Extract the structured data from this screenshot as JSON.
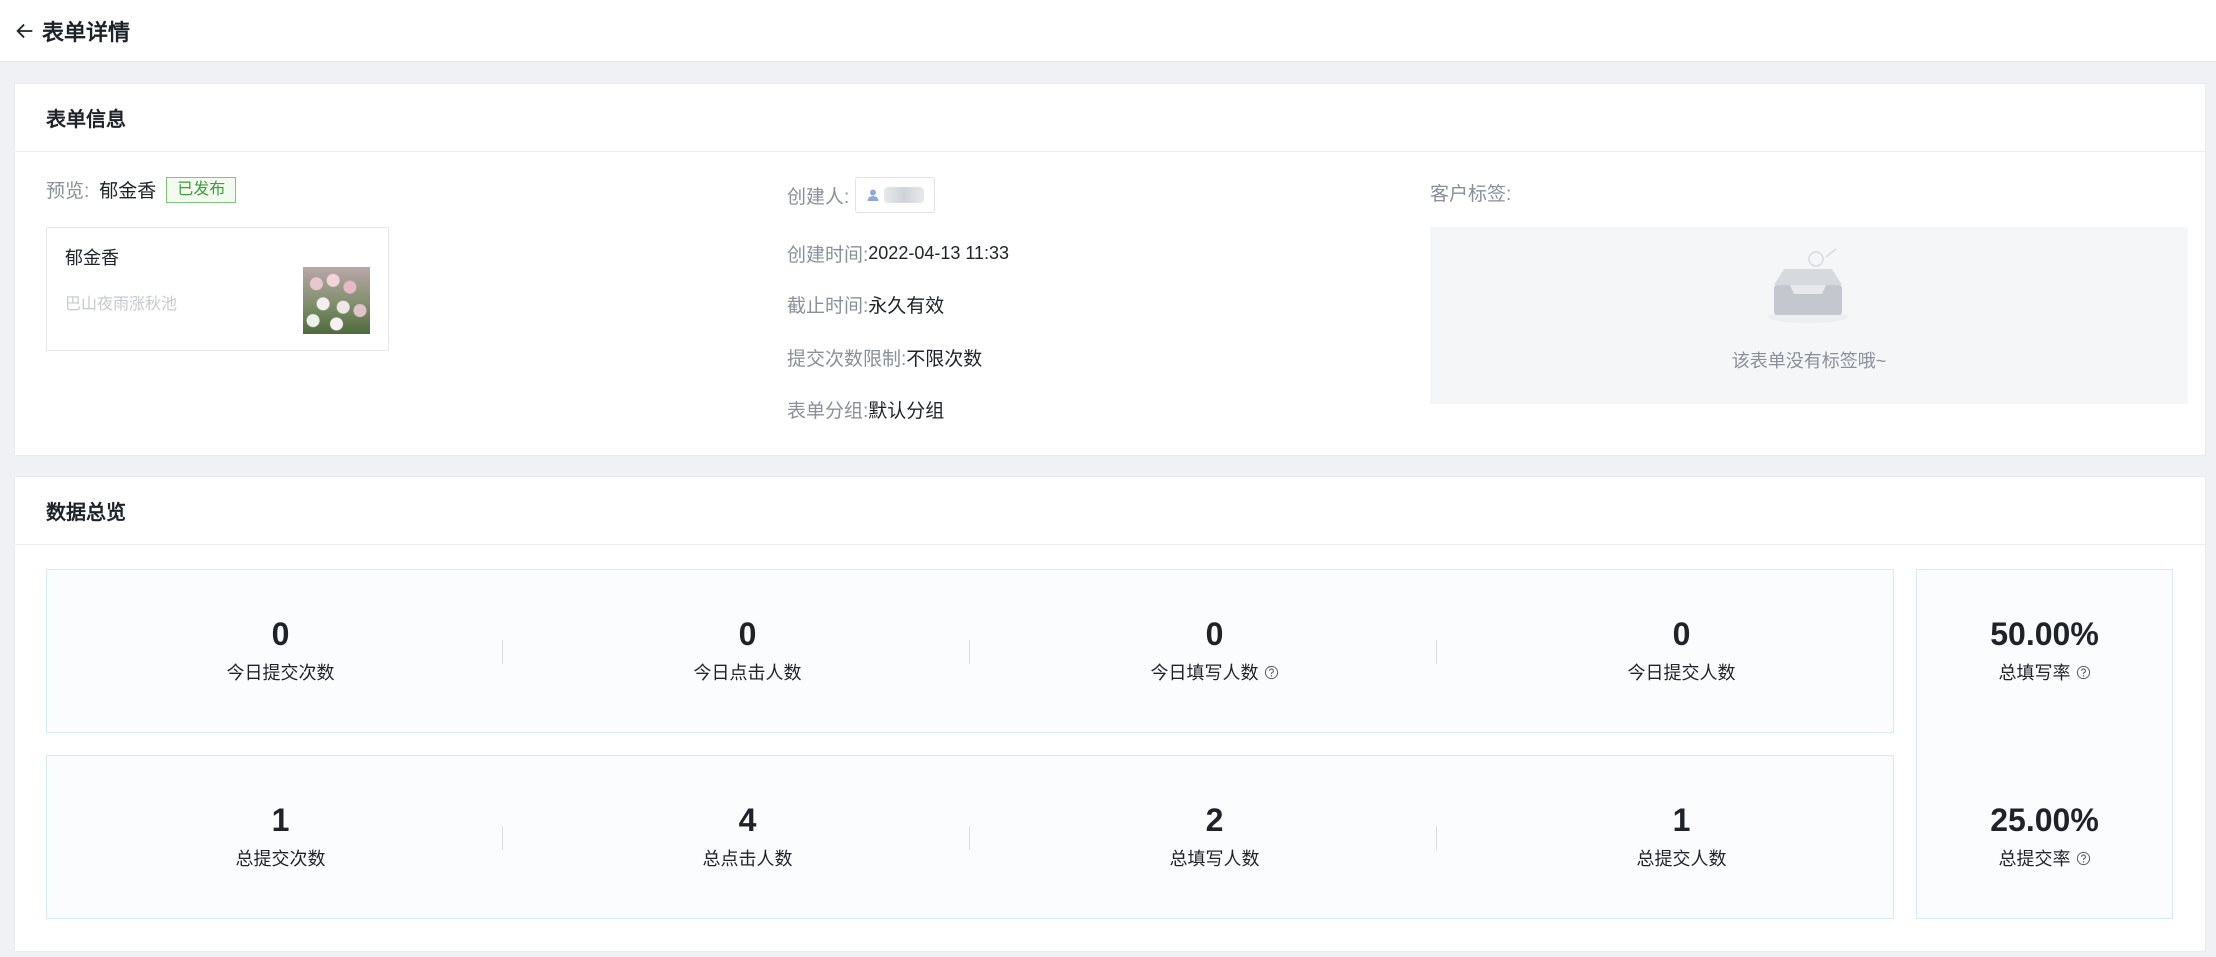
{
  "header": {
    "title": "表单详情"
  },
  "form_info": {
    "section_title": "表单信息",
    "preview_label": "预览:",
    "form_name": "郁金香",
    "status": "已发布",
    "preview_card": {
      "title": "郁金香",
      "subtitle": "巴山夜雨涨秋池"
    },
    "creator_label": "创建人:",
    "created_time_label": "创建时间:",
    "created_time": "2022-04-13 11:33",
    "deadline_label": "截止时间:",
    "deadline": "永久有效",
    "submit_limit_label": "提交次数限制:",
    "submit_limit": "不限次数",
    "group_label": "表单分组:",
    "group": "默认分组",
    "customer_tags_label": "客户标签:",
    "tags_empty_text": "该表单没有标签哦~"
  },
  "stats": {
    "section_title": "数据总览",
    "today": [
      {
        "value": "0",
        "label": "今日提交次数",
        "help": false
      },
      {
        "value": "0",
        "label": "今日点击人数",
        "help": false
      },
      {
        "value": "0",
        "label": "今日填写人数",
        "help": true
      },
      {
        "value": "0",
        "label": "今日提交人数",
        "help": false
      }
    ],
    "total": [
      {
        "value": "1",
        "label": "总提交次数",
        "help": false
      },
      {
        "value": "4",
        "label": "总点击人数",
        "help": false
      },
      {
        "value": "2",
        "label": "总填写人数",
        "help": false
      },
      {
        "value": "1",
        "label": "总提交人数",
        "help": false
      }
    ],
    "rates": [
      {
        "value": "50.00%",
        "label": "总填写率"
      },
      {
        "value": "25.00%",
        "label": "总提交率"
      }
    ]
  },
  "colors": {
    "page_bg": "#eff1f4",
    "status_green": "#3a9e3a",
    "panel_border": "#d6eaf3"
  }
}
